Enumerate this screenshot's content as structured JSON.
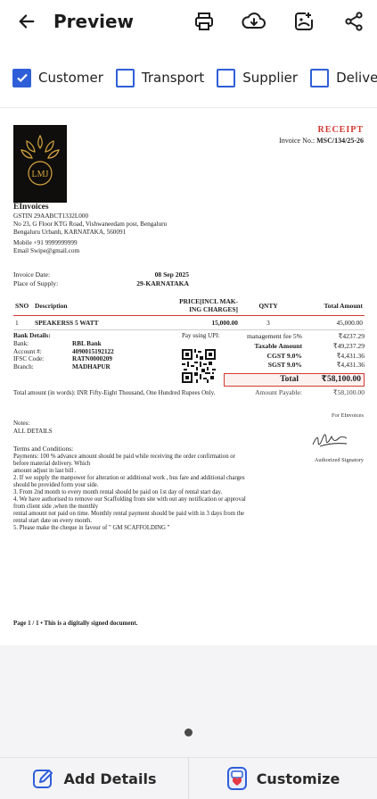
{
  "appbar": {
    "title": "Preview"
  },
  "filters": [
    {
      "label": "Customer",
      "checked": true
    },
    {
      "label": "Transport",
      "checked": false
    },
    {
      "label": "Supplier",
      "checked": false
    },
    {
      "label": "Delivery Ch",
      "checked": false
    }
  ],
  "doc": {
    "receipt_title": "RECEIPT",
    "invoice_no_label": "Invoice No.:",
    "invoice_no": "MSC/134/25-26",
    "logo_text": "LMJ",
    "company_name": "EInvoices",
    "gstin": "GSTIN 29AABCT1332L000",
    "address1": "No 23, G Floor KTG Road, Vishwaneedam post, Bengaluru",
    "address2": "Bengaluru Urbanh, KARNATAKA, 560091",
    "mobile": "Mobile +91 9999999999",
    "email": "Email Swipe@gmail.com",
    "invoice_date_label": "Invoice Date:",
    "invoice_date": "08 Sep 2025",
    "place_label": "Place of Supply:",
    "place": "29-KARNATAKA",
    "table_headers": {
      "sno": "SNO",
      "desc": "Description",
      "price": "PRICE[INCL MAK-ING CHARGES]",
      "qnty": "QNTY",
      "total": "Total Amount"
    },
    "rows": [
      {
        "sno": "1",
        "desc": "SPEAKERSS 5 WATT",
        "price": "15,000.00",
        "qnty": "3",
        "total": "45,000.00"
      }
    ],
    "bank_title": "Bank Details:",
    "bank": [
      {
        "k": "Bank:",
        "v": "RBL Bank"
      },
      {
        "k": "Account #:",
        "v": "4090015192122"
      },
      {
        "k": "IFSC Code:",
        "v": "RATN0000209"
      },
      {
        "k": "Branch:",
        "v": "MADHAPUR"
      }
    ],
    "upi_label": "Pay using UPI:",
    "totals": [
      {
        "label": "management fee 5%",
        "value": "₹4237.29",
        "bold": false
      },
      {
        "label": "Taxable Amount",
        "value": "₹49,237.29",
        "bold": true
      },
      {
        "label": "CGST 9.0%",
        "value": "₹4,431.36",
        "bold": true
      },
      {
        "label": "SGST 9.0%",
        "value": "₹4,431.36",
        "bold": true
      }
    ],
    "grand_label": "Total",
    "grand_value": "₹58,100.00",
    "payable_label": "Amount Payable:",
    "payable_value": "₹58,100.00",
    "words": "Total amount (in words): INR Fifty-Eight Thousand, One Hundred Rupees Only.",
    "for_label": "For EInvoices",
    "auth_sig": "Authorized Signatory",
    "notes_label": "Notes:",
    "notes": "ALL DETAILS",
    "terms_title": "Terms and Conditions:",
    "terms": [
      "Payments: 100 % advance amount should be paid while receiving the order confirmation or",
      "before material delivery. Which",
      "amount adjust in last bill .",
      "2. If we supply the manpower for alteration or additional work , bus fare and additional charges",
      "should be provided form your side.",
      "3. From 2nd month to every month rental should be paid on 1st day of rental start day.",
      "4. We have authorised to remove our Scaffolding from site with out any notification or approval",
      "from client side ,when the monthly",
      "rental amount not paid on time. Monthly rental payment should be paid with in 3 days from the",
      "rental start date on every month.",
      "5. Please make the cheque in favour of \" GM SCAFFOLDING \""
    ],
    "page_footer": "Page 1 / 1  •  This is a digitally signed document."
  },
  "bottom": {
    "add_details": "Add Details",
    "customize": "Customize"
  }
}
